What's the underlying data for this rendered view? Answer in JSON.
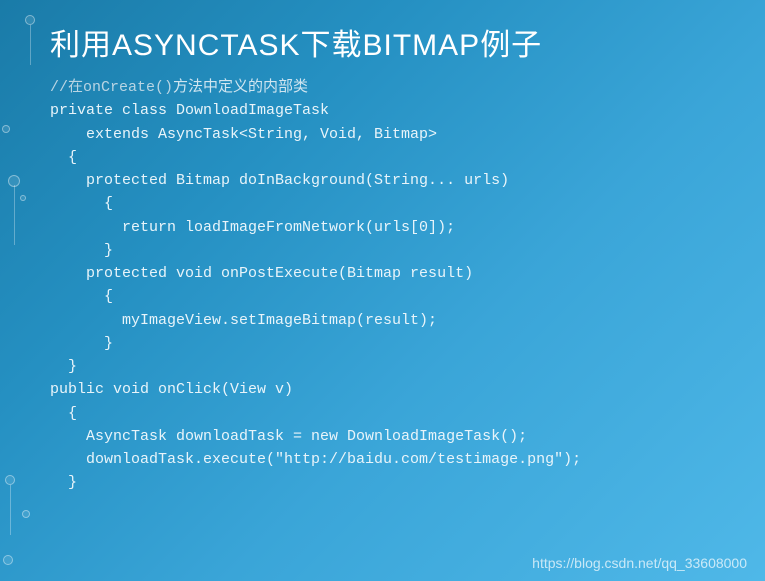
{
  "title": {
    "part1": "利用",
    "part2": "ASYNCTASK",
    "part3": "下载",
    "part4": "BITMAP",
    "part5": "例子"
  },
  "code": {
    "comment_prefix": "//在",
    "comment_method": "onCreate()",
    "comment_suffix": "方法中定义的内部类",
    "line1": "private class DownloadImageTask",
    "line2": "    extends AsyncTask<String, Void, Bitmap>",
    "line3": "  {",
    "line4": "    protected Bitmap doInBackground(String... urls)",
    "line5": "      {",
    "line6": "        return loadImageFromNetwork(urls[0]);",
    "line7": "      }",
    "line8": "",
    "line9": "    protected void onPostExecute(Bitmap result)",
    "line10": "      {",
    "line11": "        myImageView.setImageBitmap(result);",
    "line12": "      }",
    "line13": "  }",
    "line14": "",
    "line15": "",
    "line16": "public void onClick(View v)",
    "line17": "  {",
    "line18": "    AsyncTask downloadTask = new DownloadImageTask();",
    "line19": "    downloadTask.execute(\"http://baidu.com/testimage.png\");",
    "line20": "  }"
  },
  "watermark": "https://blog.csdn.net/qq_33608000"
}
